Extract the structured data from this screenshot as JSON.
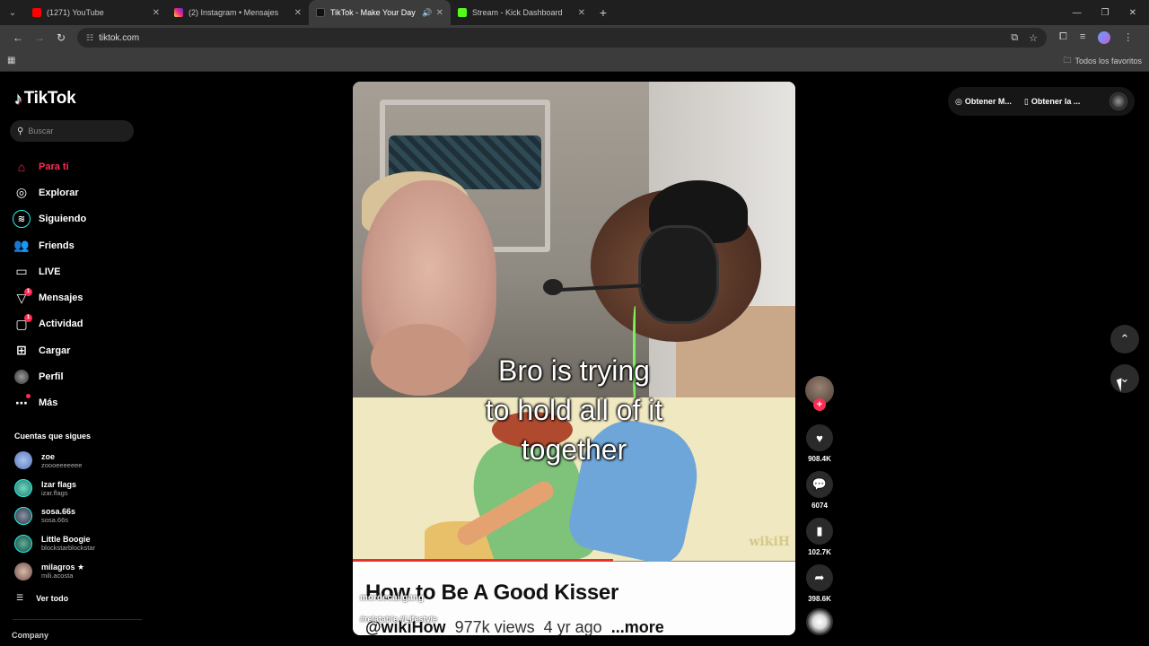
{
  "browser": {
    "tabs": [
      {
        "title": "(1271) YouTube",
        "favicon_color": "#ff0000",
        "active": false
      },
      {
        "title": "(2) Instagram • Mensajes",
        "favicon_color": "#d62976",
        "active": false
      },
      {
        "title": "TikTok - Make Your Day",
        "favicon_color": "#111111",
        "active": true
      },
      {
        "title": "Stream - Kick Dashboard",
        "favicon_color": "#53fc18",
        "active": false
      }
    ],
    "url": "tiktok.com",
    "bookmarks_folder": "Todos los favoritos"
  },
  "tiktok": {
    "logo": "TikTok",
    "search_placeholder": "Buscar",
    "menu": [
      {
        "label": "Para ti",
        "icon": "home-icon",
        "active": true
      },
      {
        "label": "Explorar",
        "icon": "compass-icon"
      },
      {
        "label": "Siguiendo",
        "icon": "following-icon"
      },
      {
        "label": "Friends",
        "icon": "friends-icon"
      },
      {
        "label": "LIVE",
        "icon": "live-icon"
      },
      {
        "label": "Mensajes",
        "icon": "messages-icon",
        "badge": "1"
      },
      {
        "label": "Actividad",
        "icon": "activity-icon",
        "badge": "1"
      },
      {
        "label": "Cargar",
        "icon": "upload-icon"
      },
      {
        "label": "Perfil",
        "icon": "profile-icon"
      },
      {
        "label": "Más",
        "icon": "more-icon",
        "dot": true
      }
    ],
    "following_title": "Cuentas que sigues",
    "following": [
      {
        "name": "zoe",
        "handle": "zoooeeeeeee",
        "color": "#7b9cd6"
      },
      {
        "name": "Izar flags",
        "handle": "izar.flags",
        "color": "#3fae9a"
      },
      {
        "name": "sosa.66s",
        "handle": "sosa.66s",
        "color": "#556070"
      },
      {
        "name": "Little Boogie",
        "handle": "blockstarblockstar",
        "color": "#2f7c68"
      },
      {
        "name": "milagros ★",
        "handle": "mili.acosta",
        "color": "#b08a80"
      }
    ],
    "see_all": "Ver todo",
    "company": "Company"
  },
  "video": {
    "caption": "Bro is trying\nto hold all of it\ntogether",
    "wikihow_logo": "wikiH",
    "embedded_title": "How to Be A Good Kisser",
    "embedded_channel": "@wikiHow",
    "embedded_views": "977k views",
    "embedded_age": "4 yr ago",
    "embedded_more": "...more",
    "username": "mordecai.gang",
    "hashtags": "#relatable #Lifestyle"
  },
  "actions": {
    "likes": "908.4K",
    "comments": "6074",
    "saves": "102.7K",
    "shares": "398.6K"
  },
  "topbar": {
    "get_coins": "Obtener M...",
    "get_app": "Obtener la ..."
  }
}
